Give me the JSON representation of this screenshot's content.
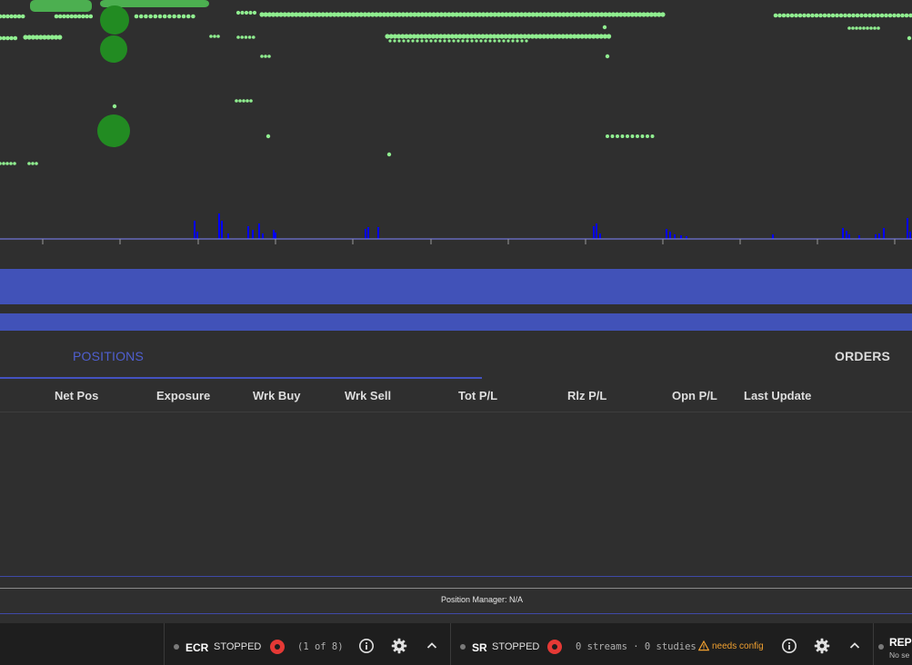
{
  "tabs": [
    {
      "label": "POSITIONS",
      "active": true
    },
    {
      "label": "ORDERS",
      "active": false
    }
  ],
  "positions_table": {
    "columns": [
      "Net Pos",
      "Exposure",
      "Wrk Buy",
      "Wrk Sell",
      "Tot P/L",
      "Rlz P/L",
      "Opn P/L",
      "Last Update"
    ],
    "rows": []
  },
  "position_manager": {
    "text": "Position Manager: N/A"
  },
  "status_bar": {
    "ecr": {
      "name": "ECR",
      "state": "STOPPED",
      "count": "(1 of 8)"
    },
    "sr": {
      "name": "SR",
      "state": "STOPPED",
      "streams": "0 streams · 0 studies",
      "warning": "needs config"
    },
    "rep": {
      "name": "REP",
      "sub": "No se"
    }
  },
  "icons": [
    "record-icon",
    "info-icon",
    "gear-icon",
    "chevron-up-icon",
    "warning-icon"
  ],
  "colors": {
    "accent": "#4152b8",
    "trade_dots": "#90ee90",
    "trade_bubbles": "#228b22",
    "volume_bars": "#0000ff",
    "record": "#e53935",
    "warning": "#f0a030"
  }
}
